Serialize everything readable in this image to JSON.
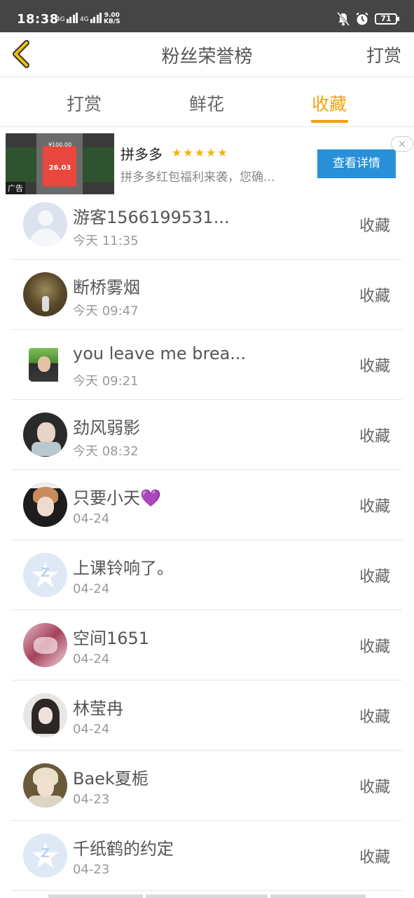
{
  "status_bar": {
    "time": "18:38",
    "network1": "4G",
    "network2": "4G",
    "speed_value": "9.00",
    "speed_unit": "KB/S",
    "battery": "71"
  },
  "header": {
    "title": "粉丝荣誉榜",
    "action": "打赏"
  },
  "tabs": [
    {
      "label": "打赏",
      "active": false
    },
    {
      "label": "鲜花",
      "active": false
    },
    {
      "label": "收藏",
      "active": true
    }
  ],
  "ad": {
    "thumb_amount_top": "¥100.00",
    "thumb_amount": "26.03",
    "badge": "广告",
    "title": "拼多多",
    "stars": "★★★★★",
    "description": "拼多多红包福利来袭，您确...",
    "cta": "查看详情",
    "close": "×"
  },
  "list": [
    {
      "name": "游客1566199531...",
      "time": "今天 11:35",
      "action": "收藏",
      "avatar": "default-avatar"
    },
    {
      "name": "断桥雾烟",
      "time": "今天 09:47",
      "action": "收藏",
      "avatar": "photo-avatar"
    },
    {
      "name": "you leave me brea...",
      "time": "今天 09:21",
      "action": "收藏",
      "avatar": "photo-avatar"
    },
    {
      "name": "劲风弱影",
      "time": "今天 08:32",
      "action": "收藏",
      "avatar": "photo-avatar"
    },
    {
      "name": "只要小天",
      "name_emoji": "💜",
      "time": "04-24",
      "action": "收藏",
      "avatar": "photo-avatar"
    },
    {
      "name": "上课铃响了。",
      "time": "04-24",
      "action": "收藏",
      "avatar": "qzone-avatar"
    },
    {
      "name": "空间1651",
      "time": "04-24",
      "action": "收藏",
      "avatar": "photo-avatar"
    },
    {
      "name": "林莹冉",
      "time": "04-24",
      "action": "收藏",
      "avatar": "photo-avatar"
    },
    {
      "name": "Baek夏栀",
      "time": "04-23",
      "action": "收藏",
      "avatar": "photo-avatar"
    },
    {
      "name": "千纸鹤的约定",
      "time": "04-23",
      "action": "收藏",
      "avatar": "qzone-avatar"
    }
  ],
  "colors": {
    "accent": "#f2a10f",
    "cta": "#2790d9",
    "status_bar": "#454545",
    "star": "#f5b400"
  }
}
